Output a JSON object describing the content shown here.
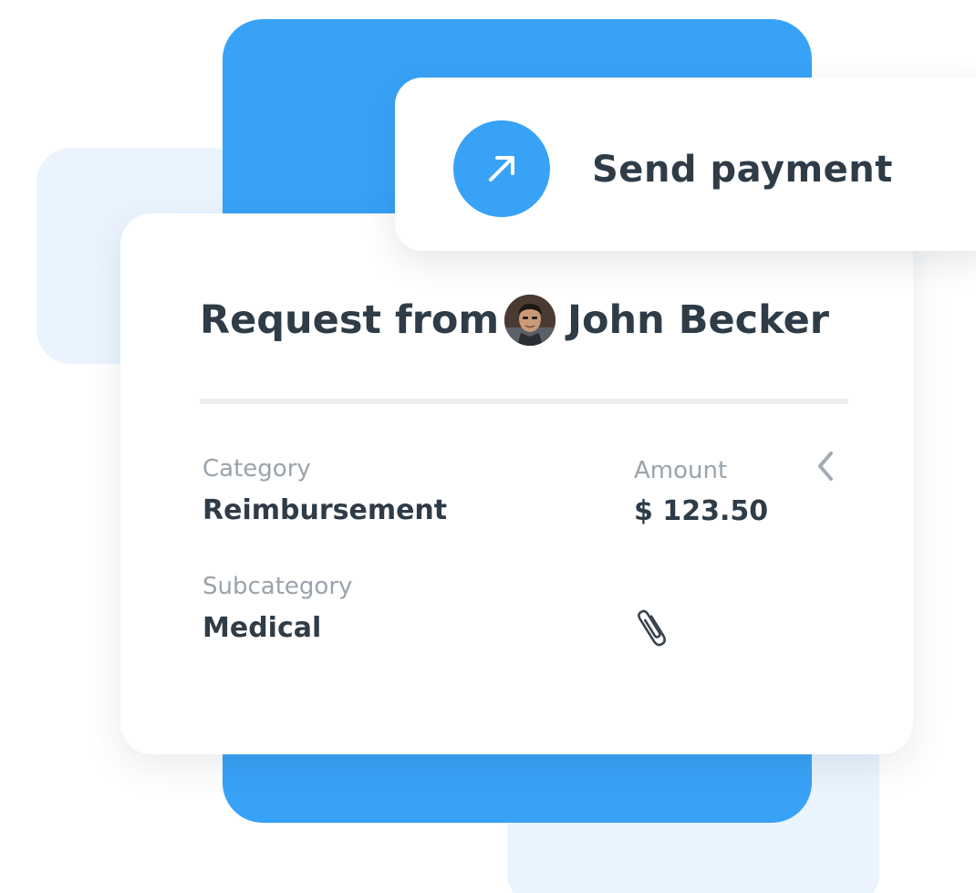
{
  "send_payment": {
    "label": "Send payment",
    "icon": "arrow-up-right-icon",
    "accent_color": "#38a2f7"
  },
  "request": {
    "title": "Request from",
    "requester_name": "John Becker"
  },
  "fields": {
    "category": {
      "label": "Category",
      "value": "Reimbursement"
    },
    "amount": {
      "label": "Amount",
      "value": "$ 123.50"
    },
    "subcategory": {
      "label": "Subcategory",
      "value": "Medical"
    }
  },
  "icons": {
    "collapse": "chevron-left-icon",
    "attachment": "paperclip-icon"
  }
}
